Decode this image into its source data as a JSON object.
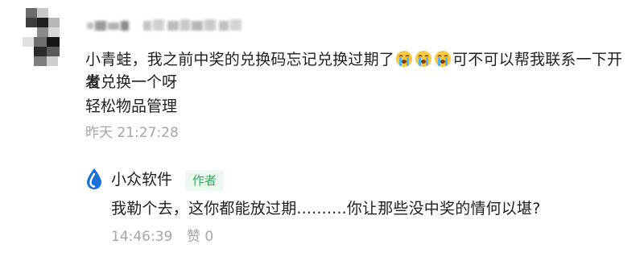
{
  "comment": {
    "text_before_emoji": "小青蛙，我之前中奖的兑换码忘记兑换过期了",
    "emoji": [
      "crying-face-icon",
      "crying-face-icon",
      "crying-face-icon"
    ],
    "text_after_emoji": "可不可以帮我联系一下开发",
    "text_line2": "者兑换一个呀",
    "text_line3": "轻松物品管理",
    "timestamp": "昨天 21:27:28"
  },
  "reply": {
    "author": "小众软件",
    "badge": "作者",
    "text": "我勒个去，这你都能放过期..........你让那些没中奖的情何以堪?",
    "time": "14:46:39",
    "like_label": "赞",
    "like_count": "0"
  },
  "colors": {
    "text": "#1f1f1f",
    "muted": "#a6a6a6",
    "badge_bg": "#edf8ef",
    "badge_text": "#3aa664",
    "logo_blue": "#1a6fd8",
    "emoji_yellow": "#f7c843"
  }
}
